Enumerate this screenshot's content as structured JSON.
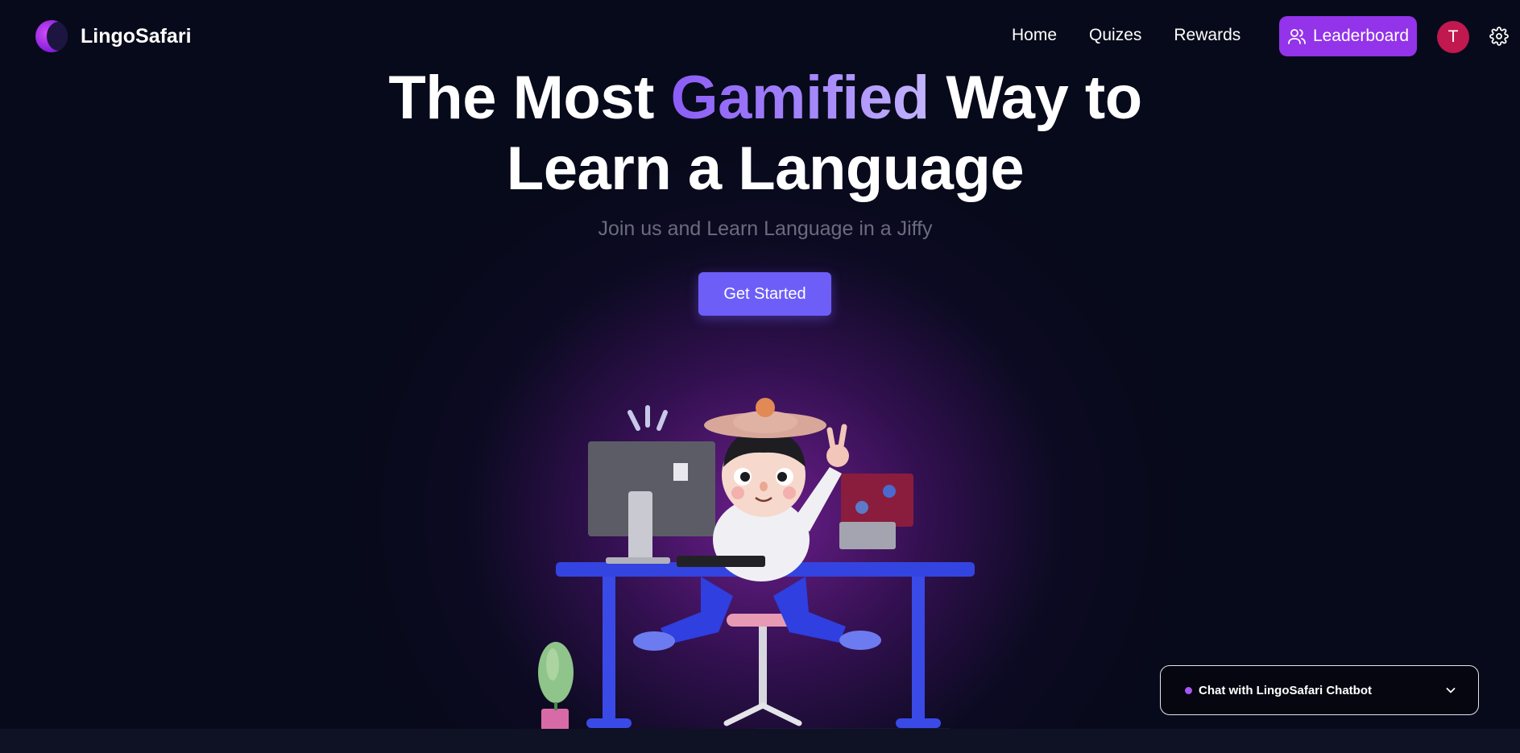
{
  "brand": {
    "name": "LingoSafari"
  },
  "nav": {
    "links": [
      "Home",
      "Quizes",
      "Rewards"
    ],
    "leaderboard_label": "Leaderboard",
    "avatar_initial": "T"
  },
  "hero": {
    "title_part1": "The Most ",
    "title_accent": "Gamified",
    "title_part2": " Way to",
    "title_line2": "Learn a Language",
    "subtitle": "Join us and Learn Language in a Jiffy",
    "cta_label": "Get Started"
  },
  "chat": {
    "label": "Chat with LingoSafari Chatbot"
  },
  "colors": {
    "background": "#070a1a",
    "accent_purple": "#9333ea",
    "cta": "#6d5ef8",
    "avatar": "#c0184f",
    "title_accent": "#8b5cf6"
  },
  "icons": [
    "logo-icon",
    "users-icon",
    "gear-icon",
    "chevron-down-icon"
  ]
}
